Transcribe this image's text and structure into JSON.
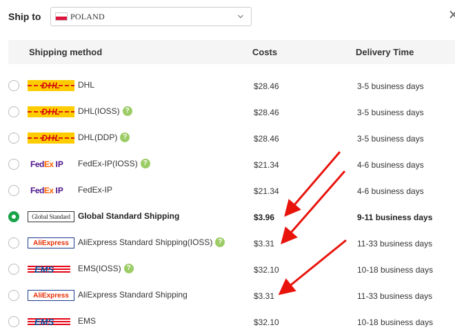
{
  "ship_to": {
    "label": "Ship to",
    "country": "POLAND",
    "flag_colors": [
      "#ffffff",
      "#dc143c"
    ]
  },
  "table": {
    "headers": {
      "method": "Shipping method",
      "costs": "Costs",
      "delivery": "Delivery Time"
    },
    "rows": [
      {
        "logo": "DHL",
        "name": "DHL",
        "help": false,
        "cost": "$28.46",
        "delivery": "3-5 business days",
        "selected": false
      },
      {
        "logo": "DHL",
        "name": "DHL(IOSS)",
        "help": true,
        "cost": "$28.46",
        "delivery": "3-5 business days",
        "selected": false
      },
      {
        "logo": "DHL",
        "name": "DHL(DDP)",
        "help": true,
        "cost": "$28.46",
        "delivery": "3-5 business days",
        "selected": false
      },
      {
        "logo": "FedEx IP",
        "name": "FedEx-IP(IOSS)",
        "help": true,
        "cost": "$21.34",
        "delivery": "4-6 business days",
        "selected": false
      },
      {
        "logo": "FedEx IP",
        "name": "FedEx-IP",
        "help": false,
        "cost": "$21.34",
        "delivery": "4-6 business days",
        "selected": false
      },
      {
        "logo": "Global Standard",
        "name": "Global Standard Shipping",
        "help": false,
        "cost": "$3.96",
        "delivery": "9-11 business days",
        "selected": true
      },
      {
        "logo": "AliExpress",
        "name": "AliExpress Standard Shipping(IOSS)",
        "help": true,
        "cost": "$3.31",
        "delivery": "11-33 business days",
        "selected": false
      },
      {
        "logo": "EMS",
        "name": "EMS(IOSS)",
        "help": true,
        "cost": "$32.10",
        "delivery": "10-18 business days",
        "selected": false
      },
      {
        "logo": "AliExpress",
        "name": "AliExpress Standard Shipping",
        "help": false,
        "cost": "$3.31",
        "delivery": "11-33 business days",
        "selected": false
      },
      {
        "logo": "EMS",
        "name": "EMS",
        "help": false,
        "cost": "$32.10",
        "delivery": "10-18 business days",
        "selected": false
      }
    ]
  },
  "help_label": "?",
  "colors": {
    "selected_radio": "#1aa34a",
    "help_badge": "#9ccc65",
    "annotation_arrow": "#e8140c",
    "dhl_yellow": "#ffcc00",
    "dhl_red": "#d40511",
    "fedex_purple": "#4d148c",
    "fedex_orange": "#ff6200"
  },
  "icons": [
    "chevron-down-icon",
    "close-icon",
    "help-icon",
    "radio-icon",
    "arrow-icon"
  ]
}
